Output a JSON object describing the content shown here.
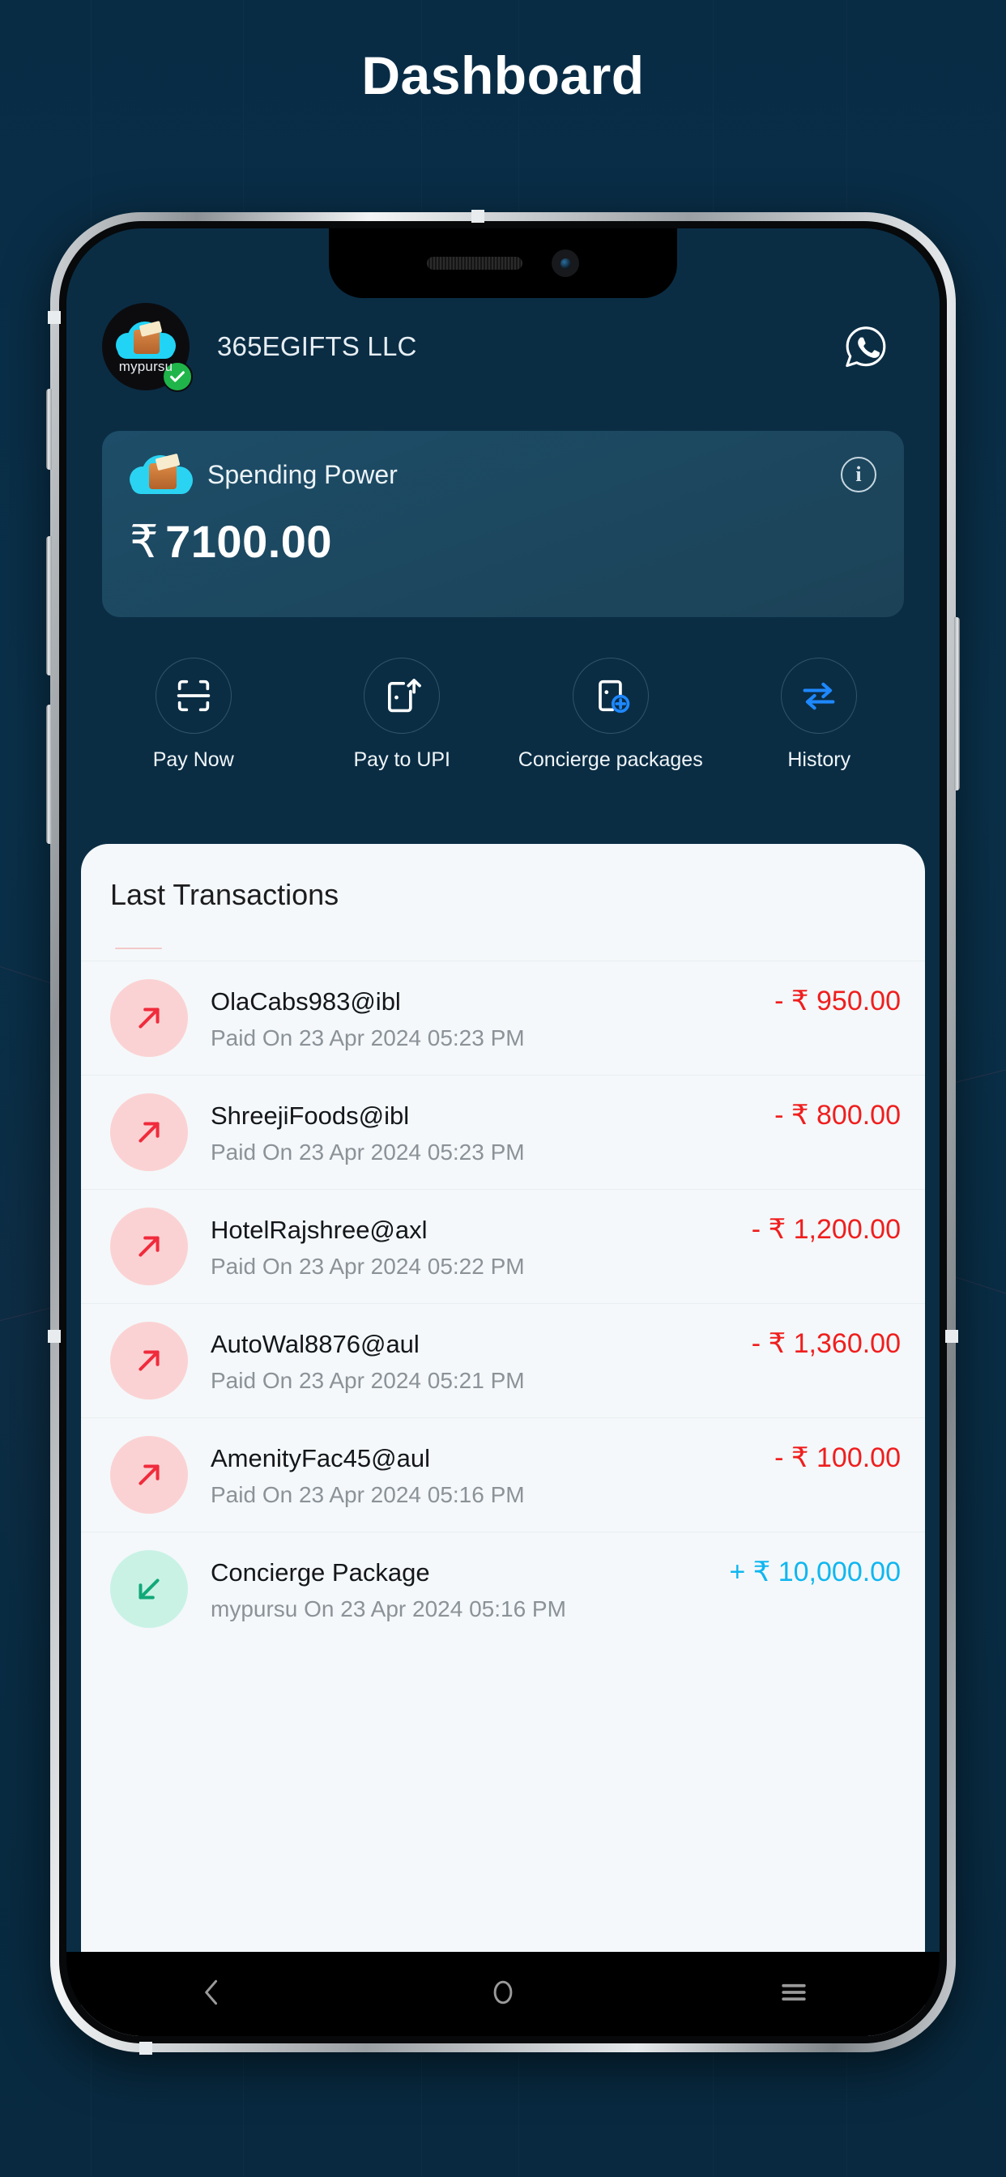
{
  "page": {
    "title": "Dashboard"
  },
  "header": {
    "logo_name": "mypursu",
    "company_name": "365EGIFTS LLC",
    "verified_icon": "verified-check-icon",
    "whatsapp_icon": "whatsapp-icon"
  },
  "spending_card": {
    "label": "Spending Power",
    "currency": "₹",
    "amount": "7100.00",
    "info_icon": "info-icon",
    "wallet_icon": "cloud-wallet-icon"
  },
  "actions": [
    {
      "label": "Pay Now",
      "icon": "scan-qr-icon"
    },
    {
      "label": "Pay to UPI",
      "icon": "wallet-upload-icon"
    },
    {
      "label": "Concierge packages",
      "icon": "wallet-plus-icon"
    },
    {
      "label": "History",
      "icon": "exchange-arrows-icon"
    }
  ],
  "transactions": {
    "title": "Last Transactions",
    "rows": [
      {
        "name": "OlaCabs983@ibl",
        "meta": "Paid On 23 Apr 2024 05:23 PM",
        "amount": "- ₹ 950.00",
        "direction": "out",
        "icon": "arrow-up-right-icon"
      },
      {
        "name": "ShreejiFoods@ibl",
        "meta": "Paid On 23 Apr 2024 05:23 PM",
        "amount": "- ₹ 800.00",
        "direction": "out",
        "icon": "arrow-up-right-icon"
      },
      {
        "name": "HotelRajshree@axl",
        "meta": "Paid On 23 Apr 2024 05:22 PM",
        "amount": "- ₹ 1,200.00",
        "direction": "out",
        "icon": "arrow-up-right-icon"
      },
      {
        "name": "AutoWal8876@aul",
        "meta": "Paid On 23 Apr 2024 05:21 PM",
        "amount": "- ₹ 1,360.00",
        "direction": "out",
        "icon": "arrow-up-right-icon"
      },
      {
        "name": "AmenityFac45@aul",
        "meta": "Paid On 23 Apr 2024 05:16 PM",
        "amount": "- ₹ 100.00",
        "direction": "out",
        "icon": "arrow-up-right-icon"
      },
      {
        "name": "Concierge Package",
        "meta": "mypursu  On 23 Apr 2024 05:16 PM",
        "amount": "+ ₹ 10,000.00",
        "direction": "in",
        "icon": "arrow-down-left-icon"
      }
    ]
  },
  "navbar": {
    "back_icon": "back-chevron-icon",
    "home_icon": "home-circle-icon",
    "recents_icon": "recents-menu-icon"
  },
  "colors": {
    "page_background": "#082c44",
    "screen_background": "#0a2d44",
    "card_background": "#1d4d68",
    "panel_background": "#f4f8fa",
    "debit": "#f01e1e",
    "credit": "#10b6f0",
    "debit_avatar": "#fbd2d3",
    "credit_avatar": "#c9f2e5",
    "accent_cyan": "#2bd3f2",
    "accent_blue": "#1e88ff"
  }
}
